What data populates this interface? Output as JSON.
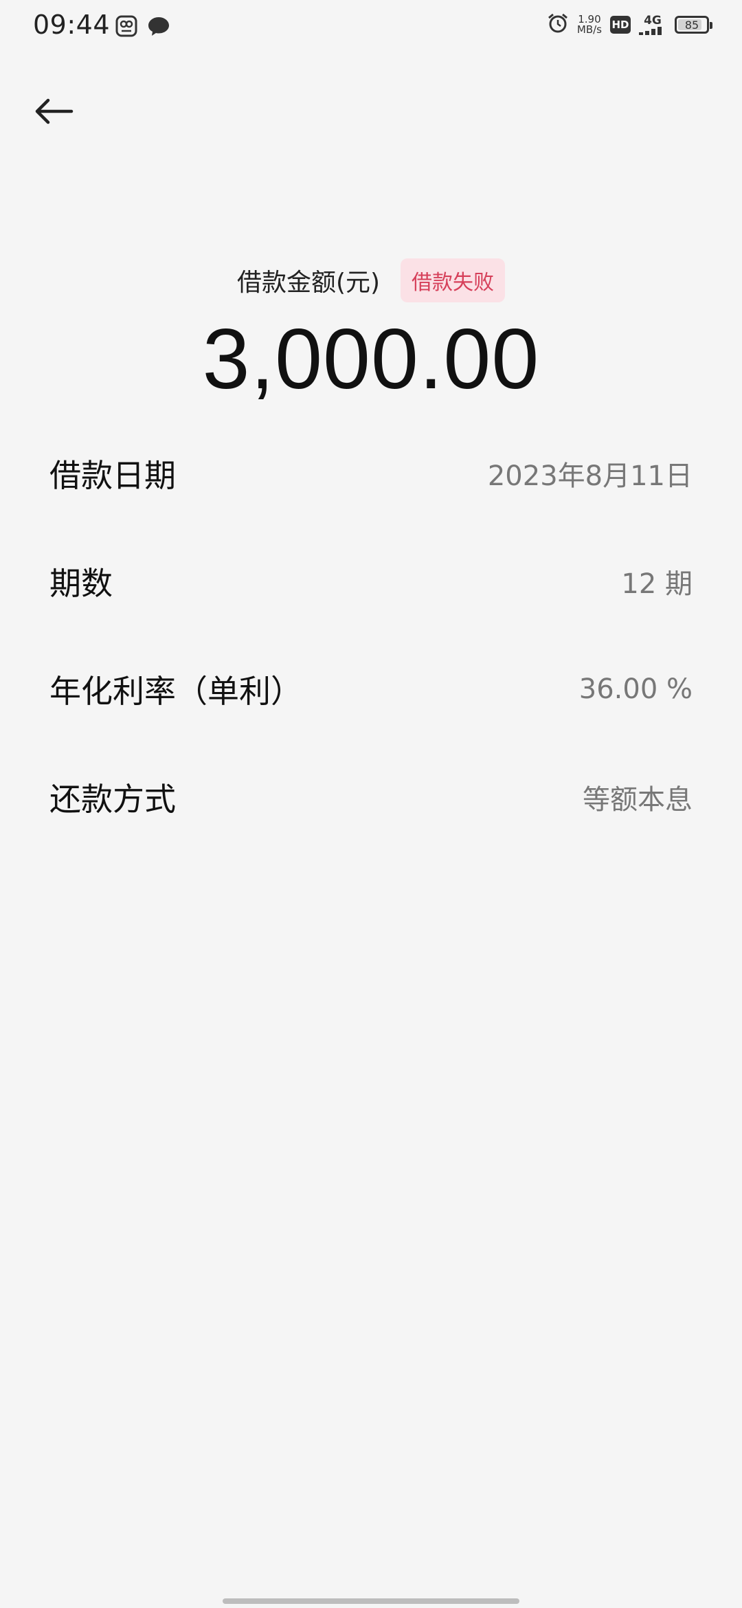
{
  "status_bar": {
    "time": "09:44",
    "net_speed_value": "1.90",
    "net_speed_unit": "MB/s",
    "hd_label": "HD",
    "network_label": "4G",
    "battery_level": "85",
    "battery_fraction": 0.85
  },
  "header": {
    "amount_label": "借款金额(元)",
    "status_badge": "借款失败",
    "amount_value": "3,000.00"
  },
  "details": [
    {
      "label": "借款日期",
      "value": "2023年8月11日"
    },
    {
      "label": "期数",
      "value": "12 期"
    },
    {
      "label": "年化利率（单利）",
      "value": "36.00 %"
    },
    {
      "label": "还款方式",
      "value": "等额本息"
    }
  ],
  "colors": {
    "background": "#f5f5f5",
    "badge_text": "#d6405a",
    "badge_background": "#fbe1e6",
    "value_text": "#777777"
  },
  "icons": {
    "back": "arrow-left-icon",
    "status_left": [
      "app-notification-icon",
      "message-bubble-icon"
    ],
    "status_right": [
      "alarm-icon",
      "hd-icon",
      "signal-4g-icon",
      "battery-icon"
    ]
  }
}
